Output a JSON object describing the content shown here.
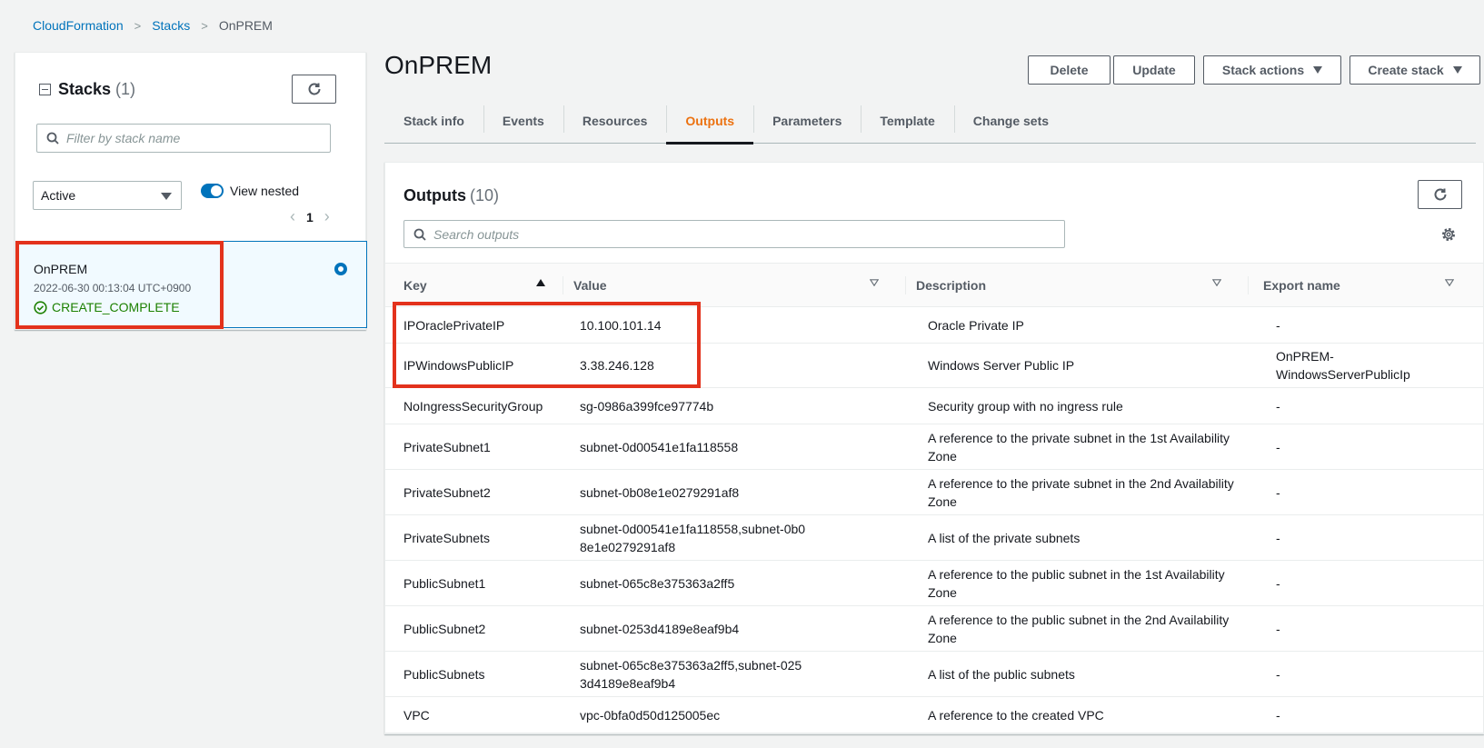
{
  "breadcrumb": {
    "root": "CloudFormation",
    "stacks": "Stacks",
    "current": "OnPREM"
  },
  "sidebar": {
    "title": "Stacks",
    "count": "(1)",
    "search_placeholder": "Filter by stack name",
    "filter_value": "Active",
    "toggle_label": "View nested",
    "toggle_on": true,
    "page": "1",
    "stack": {
      "name": "OnPREM",
      "date": "2022-06-30 00:13:04 UTC+0900",
      "status": "CREATE_COMPLETE"
    }
  },
  "main": {
    "title": "OnPREM",
    "buttons": {
      "delete": "Delete",
      "update": "Update",
      "stack_actions": "Stack actions",
      "create_stack": "Create stack"
    },
    "tabs": [
      "Stack info",
      "Events",
      "Resources",
      "Outputs",
      "Parameters",
      "Template",
      "Change sets"
    ],
    "active_tab": "Outputs",
    "outputs": {
      "title": "Outputs",
      "count": "(10)",
      "search_placeholder": "Search outputs",
      "columns": {
        "key": "Key",
        "value": "Value",
        "description": "Description",
        "export": "Export name"
      },
      "rows": [
        {
          "key": "IPOraclePrivateIP",
          "value": "10.100.101.14",
          "description": "Oracle Private IP",
          "export": "-"
        },
        {
          "key": "IPWindowsPublicIP",
          "value": "3.38.246.128",
          "description": "Windows Server Public IP",
          "export": "OnPREM-WindowsServerPublicIp"
        },
        {
          "key": "NoIngressSecurityGroup",
          "value": "sg-0986a399fce97774b",
          "description": "Security group with no ingress rule",
          "export": "-"
        },
        {
          "key": "PrivateSubnet1",
          "value": "subnet-0d00541e1fa118558",
          "description": "A reference to the private subnet in the 1st Availability Zone",
          "export": "-"
        },
        {
          "key": "PrivateSubnet2",
          "value": "subnet-0b08e1e0279291af8",
          "description": "A reference to the private subnet in the 2nd Availability Zone",
          "export": "-"
        },
        {
          "key": "PrivateSubnets",
          "value": "subnet-0d00541e1fa118558,subnet-0b08e1e0279291af8",
          "description": "A list of the private subnets",
          "export": "-"
        },
        {
          "key": "PublicSubnet1",
          "value": "subnet-065c8e375363a2ff5",
          "description": "A reference to the public subnet in the 1st Availability Zone",
          "export": "-"
        },
        {
          "key": "PublicSubnet2",
          "value": "subnet-0253d4189e8eaf9b4",
          "description": "A reference to the public subnet in the 2nd Availability Zone",
          "export": "-"
        },
        {
          "key": "PublicSubnets",
          "value": "subnet-065c8e375363a2ff5,subnet-0253d4189e8eaf9b4",
          "description": "A list of the public subnets",
          "export": "-"
        },
        {
          "key": "VPC",
          "value": "vpc-0bfa0d50d125005ec",
          "description": "A reference to the created VPC",
          "export": "-"
        }
      ]
    }
  },
  "colors": {
    "accent": "#0073bb",
    "active_tab": "#ec7211",
    "success": "#1d8102",
    "highlight": "#e3321c"
  }
}
